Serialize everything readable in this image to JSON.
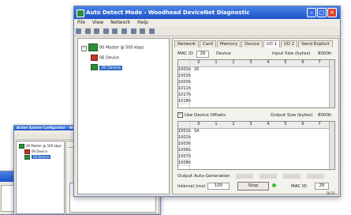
{
  "colors": {
    "title_bar": "#2a5fd6",
    "close_button": "#d9462a",
    "selected": "#316ac5",
    "device_icon": "#2f8f3a",
    "error_icon": "#c8342a"
  },
  "main": {
    "title": "Auto Detect Mode - Woodhead DeviceNet Diagnostic",
    "menu": [
      "File",
      "View",
      "Network",
      "Help"
    ],
    "tree": {
      "master": "00 Master @ 500 kbps",
      "devices": [
        "06 Device",
        "26 Device"
      ]
    },
    "tabs": [
      "Network",
      "Card",
      "Memory",
      "Device",
      "I/O 1",
      "I/O 2",
      "Send Explicit"
    ],
    "mac_id_label": "MAC ID",
    "mac_id_value": "26",
    "device_label": "Device",
    "input_size_label": "Input Size (bytes)",
    "input_size_value": "8000h",
    "columns": [
      "0",
      "1",
      "2",
      "3",
      "4",
      "5",
      "6",
      "7"
    ],
    "input_rows": [
      {
        "offset": "1001h",
        "value": "26"
      },
      {
        "offset": "1002h",
        "value": ""
      },
      {
        "offset": "1003h",
        "value": ""
      },
      {
        "offset": "1011h",
        "value": ""
      },
      {
        "offset": "1017h",
        "value": ""
      },
      {
        "offset": "1018h",
        "value": ""
      }
    ],
    "use_offsets_label": "Use Device Offsets",
    "output_size_label": "Output Size (bytes)",
    "output_size_value": "8000h",
    "output_rows": [
      {
        "offset": "1001h",
        "value": "5A"
      },
      {
        "offset": "1002h",
        "value": ""
      },
      {
        "offset": "1003h",
        "value": ""
      },
      {
        "offset": "1006h",
        "value": ""
      },
      {
        "offset": "1007h",
        "value": ""
      },
      {
        "offset": "1008h",
        "value": ""
      }
    ],
    "auto_gen_label": "Output Auto-Generation",
    "interval_label": "Interval (ms)",
    "interval_value": "100",
    "stop_label": "Stop",
    "mac_id_label_2": "MAC ID",
    "mac_id_value_2": "26",
    "status": "16:31"
  },
  "second": {
    "title": "Active System Configurator - Woodhead DeviceNet Diagnostic",
    "tree": {
      "master": "00 Master @ 500 kbps",
      "devices": [
        "06 Device",
        "26 Device"
      ]
    }
  }
}
